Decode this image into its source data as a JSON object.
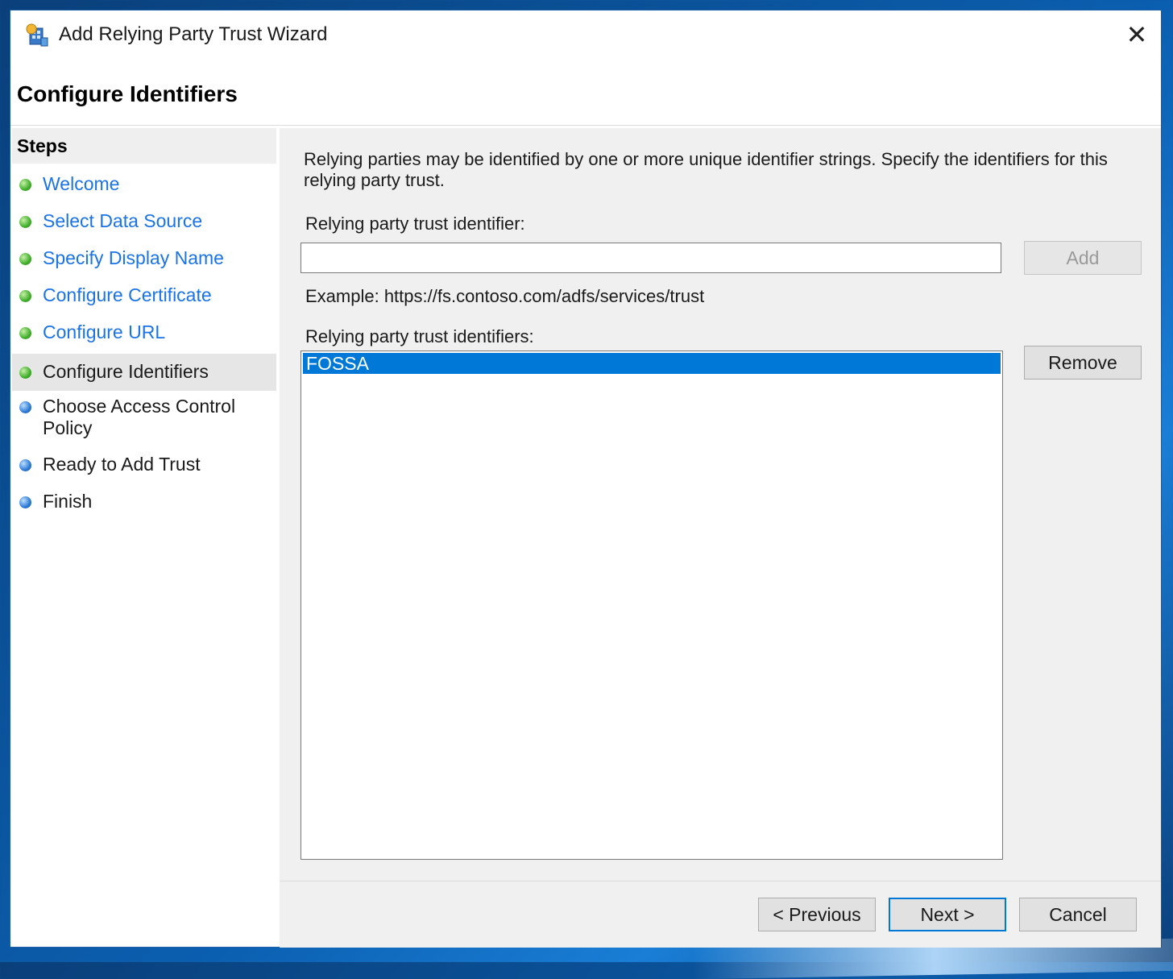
{
  "window": {
    "title": "Add Relying Party Trust Wizard",
    "close_glyph": "✕"
  },
  "page": {
    "title": "Configure Identifiers"
  },
  "steps": {
    "header": "Steps",
    "items": [
      {
        "label": "Welcome",
        "state": "done"
      },
      {
        "label": "Select Data Source",
        "state": "done"
      },
      {
        "label": "Specify Display Name",
        "state": "done"
      },
      {
        "label": "Configure Certificate",
        "state": "done"
      },
      {
        "label": "Configure URL",
        "state": "done"
      },
      {
        "label": "Configure Identifiers",
        "state": "current"
      },
      {
        "label": "Choose Access Control Policy",
        "state": "pending"
      },
      {
        "label": "Ready to Add Trust",
        "state": "pending"
      },
      {
        "label": "Finish",
        "state": "pending"
      }
    ]
  },
  "content": {
    "intro": "Relying parties may be identified by one or more unique identifier strings. Specify the identifiers for this relying party trust.",
    "identifier_label": "Relying party trust identifier:",
    "identifier_value": "",
    "add_button": "Add",
    "example": "Example: https://fs.contoso.com/adfs/services/trust",
    "identifiers_label": "Relying party trust identifiers:",
    "identifiers": [
      "FOSSA"
    ],
    "remove_button": "Remove"
  },
  "footer": {
    "previous": "< Previous",
    "next": "Next >",
    "cancel": "Cancel"
  },
  "colors": {
    "accent": "#0078d7",
    "link": "#1a73e8",
    "done_dot": "#3fae2a",
    "pending_dot": "#2b79d6"
  }
}
